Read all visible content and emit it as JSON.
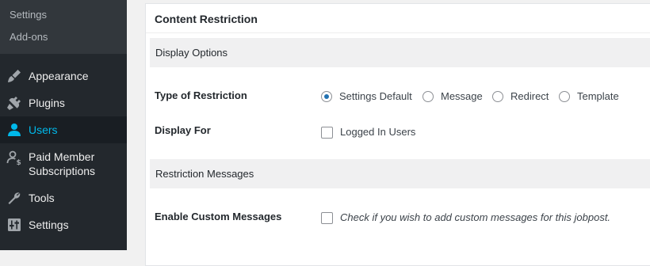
{
  "sidebar": {
    "submenu": [
      {
        "label": "Settings"
      },
      {
        "label": "Add-ons"
      }
    ],
    "menu": [
      {
        "label": "Appearance",
        "icon": "paintbrush-icon"
      },
      {
        "label": "Plugins",
        "icon": "plugin-icon"
      },
      {
        "label": "Users",
        "icon": "users-icon",
        "active": true
      },
      {
        "label_line1": "Paid Member",
        "label_line2": "Subscriptions",
        "icon": "member-dollar-icon"
      },
      {
        "label": "Tools",
        "icon": "wrench-icon"
      },
      {
        "label": "Settings",
        "icon": "sliders-icon"
      }
    ]
  },
  "panel": {
    "title": "Content Restriction",
    "sections": [
      {
        "title": "Display Options"
      },
      {
        "title": "Restriction Messages"
      }
    ],
    "type_of_restriction": {
      "label": "Type of Restriction",
      "options": [
        "Settings Default",
        "Message",
        "Redirect",
        "Template"
      ],
      "selected": "Settings Default"
    },
    "display_for": {
      "label": "Display For",
      "option": "Logged In Users",
      "checked": false
    },
    "custom_messages": {
      "label": "Enable Custom Messages",
      "description": "Check if you wish to add custom messages for this jobpost.",
      "checked": false
    }
  },
  "colors": {
    "sidebar_bg": "#23282d",
    "submenu_bg": "#32373c",
    "active_bg": "#191e23",
    "active_text": "#00b9eb",
    "radio_selected": "#2271b1",
    "section_band": "#f0f0f1"
  }
}
